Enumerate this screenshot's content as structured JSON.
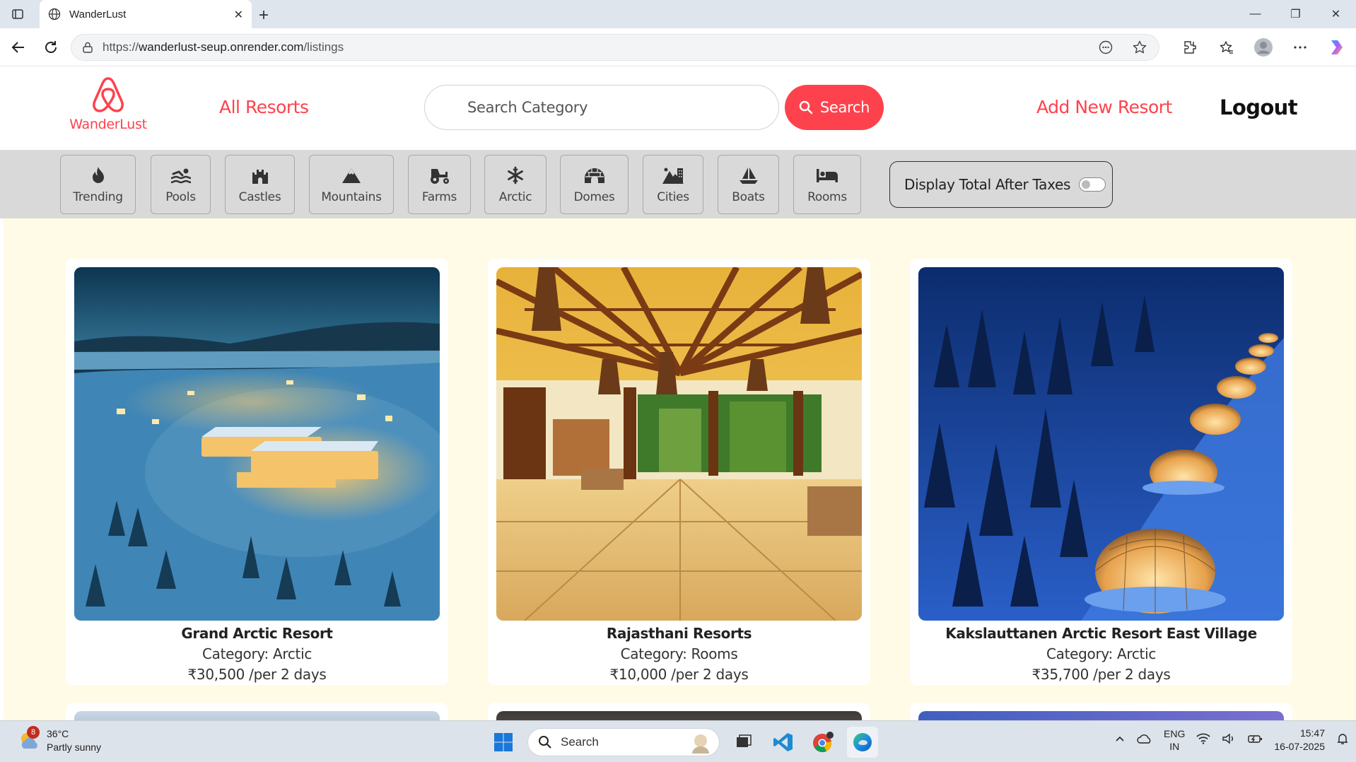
{
  "browser": {
    "tab_title": "WanderLust",
    "url_prefix": "https://",
    "url_main": "wanderlust-seup.onrender.com",
    "url_path": "/listings"
  },
  "nav": {
    "logo_text": "WanderLust",
    "all_resorts": "All Resorts",
    "search_placeholder": "Search Category",
    "search_button": "Search",
    "add_new": "Add New Resort",
    "logout": "Logout"
  },
  "filters": [
    {
      "label": "Trending",
      "icon": "fire-icon"
    },
    {
      "label": "Pools",
      "icon": "swimmer-icon"
    },
    {
      "label": "Castles",
      "icon": "castle-icon"
    },
    {
      "label": "Mountains",
      "icon": "mountain-icon"
    },
    {
      "label": "Farms",
      "icon": "tractor-icon"
    },
    {
      "label": "Arctic",
      "icon": "snowflake-icon"
    },
    {
      "label": "Domes",
      "icon": "igloo-icon"
    },
    {
      "label": "Cities",
      "icon": "city-icon"
    },
    {
      "label": "Boats",
      "icon": "sailboat-icon"
    },
    {
      "label": "Rooms",
      "icon": "bed-icon"
    }
  ],
  "tax_toggle": {
    "label": "Display Total After Taxes",
    "on": false
  },
  "listings": [
    {
      "title": "Grand Arctic Resort",
      "category": "Category: Arctic",
      "price": "₹30,500 /per 2 days"
    },
    {
      "title": "Rajasthani Resorts",
      "category": "Category: Rooms",
      "price": "₹10,000 /per 2 days"
    },
    {
      "title": "Kakslauttanen Arctic Resort East Village",
      "category": "Category: Arctic",
      "price": "₹35,700 /per 2 days"
    }
  ],
  "taskbar": {
    "weather_temp": "36°C",
    "weather_desc": "Partly sunny",
    "weather_badge": "8",
    "search_label": "Search",
    "lang_1": "ENG",
    "lang_2": "IN",
    "time": "15:47",
    "date": "16-07-2025"
  },
  "colors": {
    "brand": "#fe424d",
    "filter_bg": "#d9d9d9",
    "listing_bg": "#fffbe6"
  }
}
